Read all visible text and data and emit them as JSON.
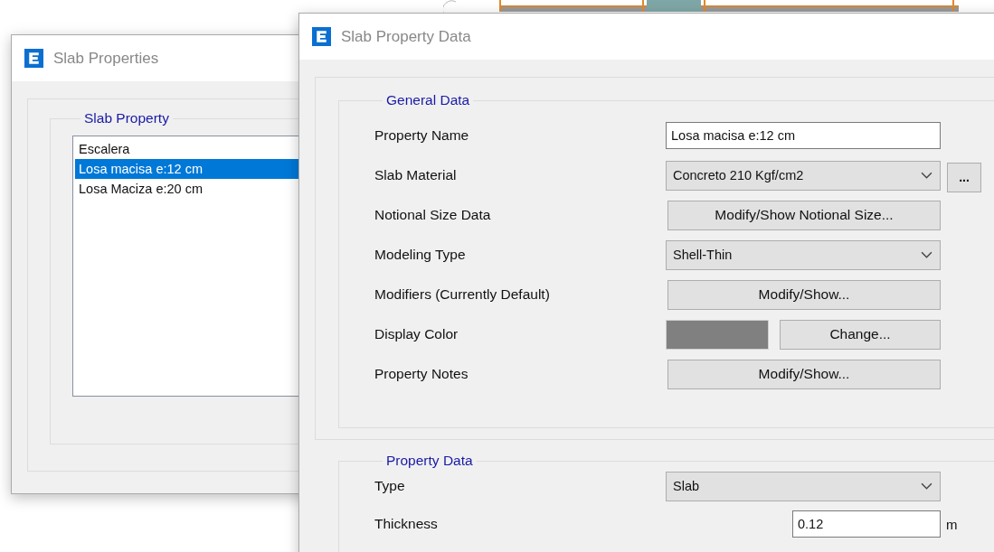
{
  "slab_properties": {
    "title": "Slab Properties",
    "group_title": "Slab Property",
    "items": [
      {
        "label": "Escalera",
        "selected": false
      },
      {
        "label": "Losa macisa e:12 cm",
        "selected": true
      },
      {
        "label": "Losa Maciza e:20 cm",
        "selected": false
      }
    ]
  },
  "slab_property_data": {
    "title": "Slab Property Data",
    "general_data": {
      "title": "General Data",
      "rows": [
        {
          "label": "Property Name",
          "kind": "text",
          "value": "Losa macisa e:12 cm"
        },
        {
          "label": "Slab Material",
          "kind": "combo",
          "value": "Concreto 210 Kgf/cm2",
          "extra_button": "..."
        },
        {
          "label": "Notional Size Data",
          "kind": "button",
          "button": "Modify/Show Notional Size..."
        },
        {
          "label": "Modeling Type",
          "kind": "combo",
          "value": "Shell-Thin"
        },
        {
          "label": "Modifiers (Currently Default)",
          "kind": "button",
          "button": "Modify/Show..."
        },
        {
          "label": "Display Color",
          "kind": "color",
          "color": "#808080",
          "button": "Change..."
        },
        {
          "label": "Property Notes",
          "kind": "button",
          "button": "Modify/Show..."
        }
      ]
    },
    "property_data": {
      "title": "Property Data",
      "rows": [
        {
          "label": "Type",
          "kind": "combo",
          "value": "Slab"
        },
        {
          "label": "Thickness",
          "kind": "number",
          "value": "0.12",
          "unit": "m"
        }
      ]
    }
  }
}
